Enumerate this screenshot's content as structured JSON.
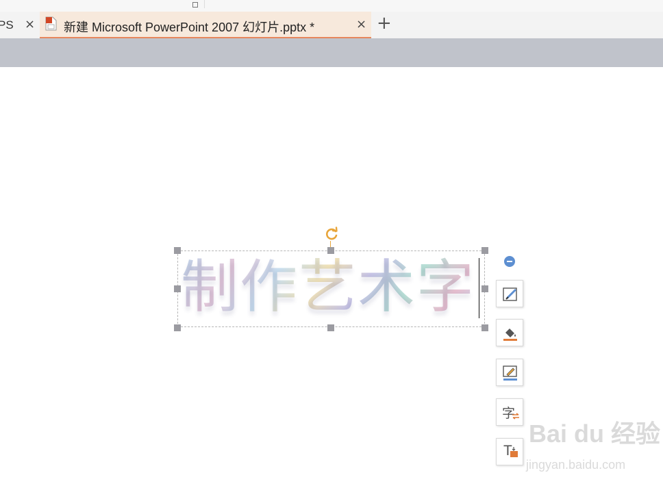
{
  "tabs": [
    {
      "label": "PS",
      "close": "×"
    },
    {
      "label": "新建 Microsoft PowerPoint 2007 幻灯片.pptx *",
      "close": "×",
      "icon": "pptx-file-icon"
    }
  ],
  "new_tab": "+",
  "slide": {
    "art_text": "制作艺术字"
  },
  "float_toolbar": {
    "collapse_icon": "minus-circle-icon",
    "buttons": [
      {
        "icon": "shape-style-icon"
      },
      {
        "icon": "fill-bucket-icon"
      },
      {
        "icon": "outline-pen-icon"
      },
      {
        "icon": "text-effects-icon",
        "glyph": "字"
      },
      {
        "icon": "text-box-icon",
        "glyph": "T"
      }
    ]
  },
  "colors": {
    "active_tab_bg": "#f7e9dc",
    "active_tab_underline": "#e8875d",
    "toolbar_band": "#c0c3cb",
    "handle": "#9b9ba1",
    "rotate": "#e8a53a",
    "accent_blue": "#5d8fd1",
    "accent_orange": "#e07b39"
  },
  "watermark": {
    "logo": "Bai du 经验",
    "url": "jingyan.baidu.com"
  }
}
